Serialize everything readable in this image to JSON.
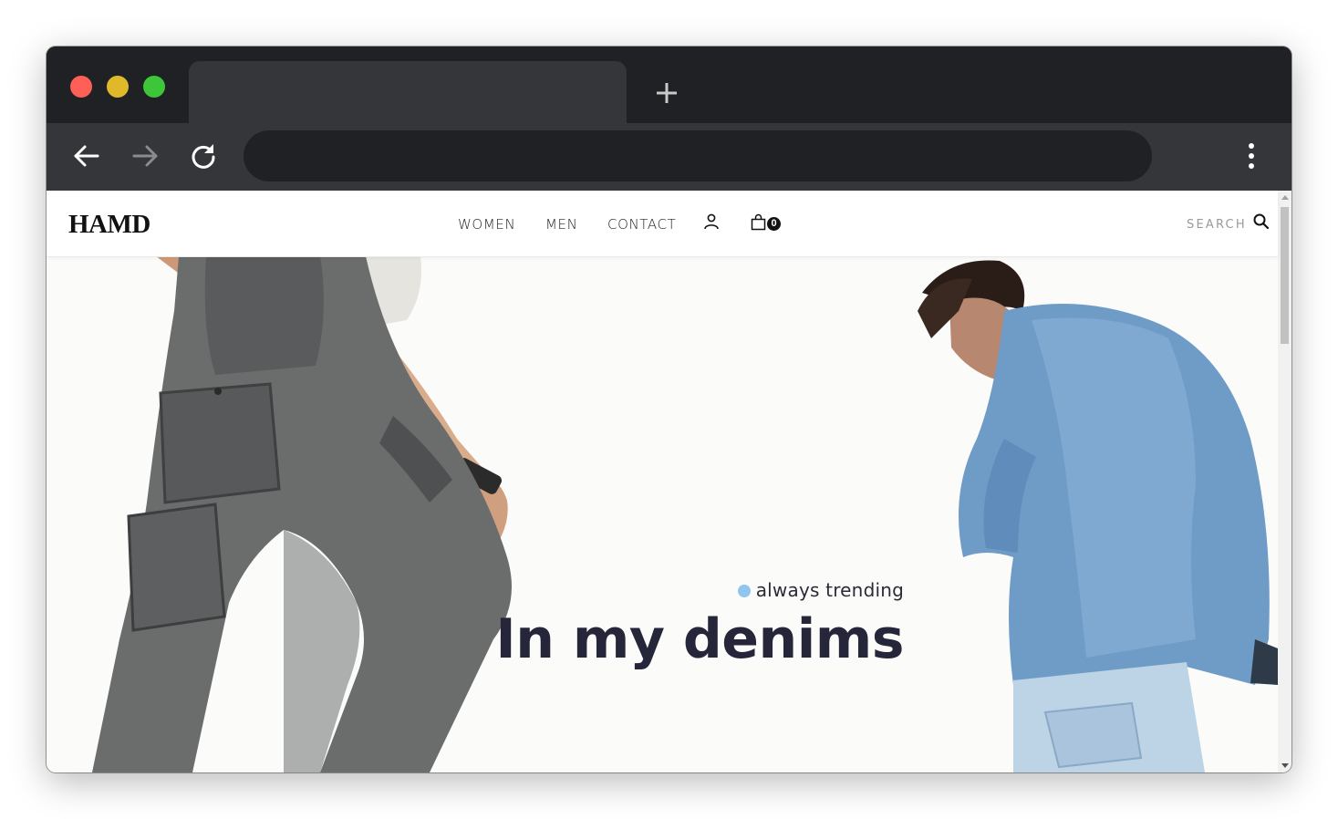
{
  "browser": {
    "new_tab_label": "+",
    "address_placeholder": ""
  },
  "site": {
    "logo": "HAMD",
    "nav": [
      "WOMEN",
      "MEN",
      "CONTACT"
    ],
    "cart_count": "0",
    "search_label": "SEARCH"
  },
  "hero": {
    "eyebrow": "always trending",
    "headline": "In my denims",
    "accent_color": "#8ec6ef",
    "headline_color": "#26263a"
  }
}
